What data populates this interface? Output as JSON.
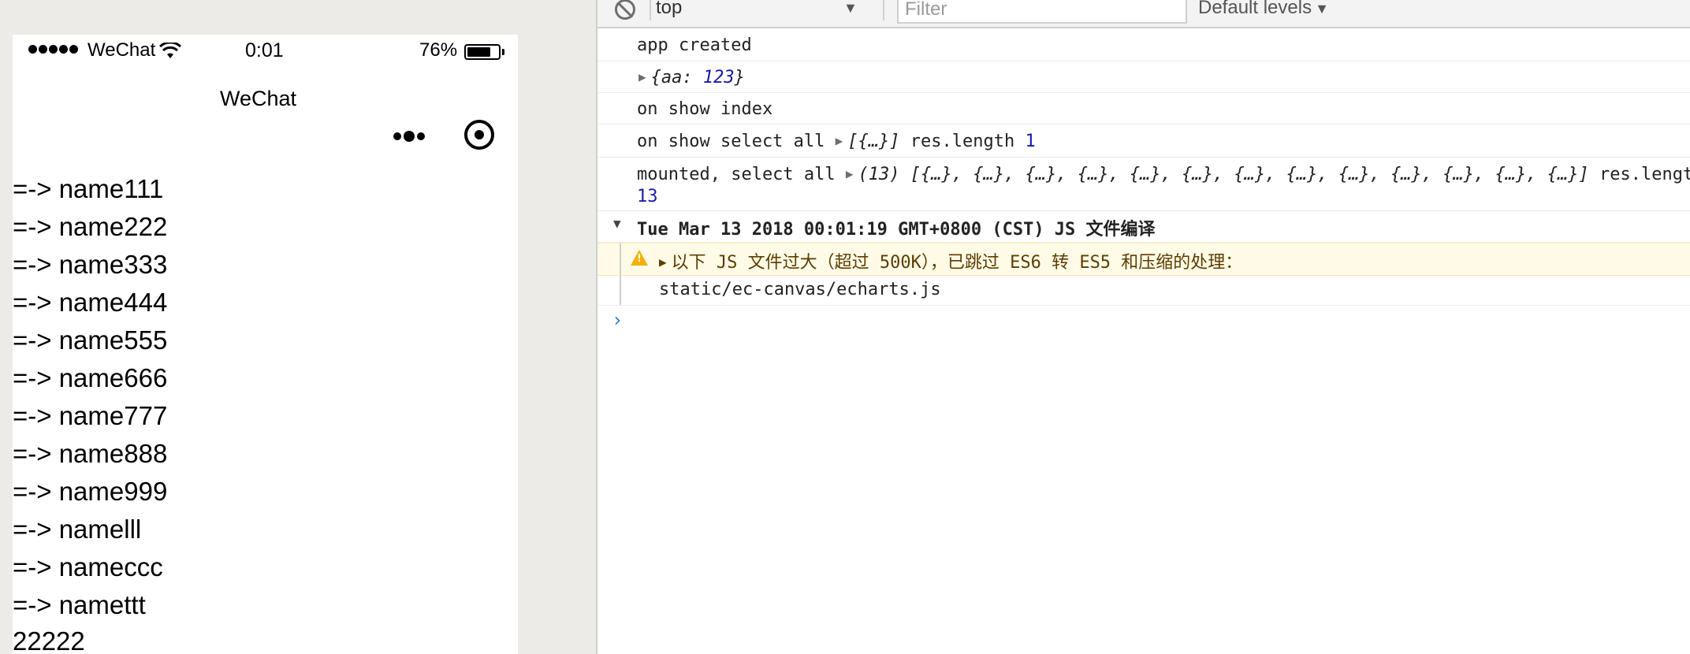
{
  "statusbar": {
    "carrier": "WeChat",
    "time": "0:01",
    "battery_percent": "76%",
    "battery_level": 0.76,
    "signal_bars": 5
  },
  "navbar": {
    "title": "WeChat",
    "more_icon": "more-dots-icon",
    "close_icon": "target-close-icon"
  },
  "page": {
    "items": [
      "=-> name111",
      "=-> name222",
      "=-> name333",
      "=-> name444",
      "=-> name555",
      "=-> name666",
      "=-> name777",
      "=-> name888",
      "=-> name999",
      "=-> namelll",
      "=-> nameccc",
      "=-> namettt"
    ],
    "footer": "22222"
  },
  "devtools": {
    "toolbar": {
      "context": "top",
      "filter_placeholder": "Filter",
      "levels": "Default levels"
    },
    "console": {
      "app_created": "app created",
      "obj_open": "{aa: ",
      "obj_val": "123",
      "obj_close": "}",
      "on_show_index": "on show index",
      "select_all_label": "on show select all",
      "select_all_preview": "[{…}]",
      "select_all_len_label": "res.length",
      "select_all_len": "1",
      "mounted_label": "mounted, select all",
      "mounted_preview": "(13) [{…}, {…}, {…}, {…}, {…}, {…}, {…}, {…}, {…}, {…}, {…}, {…}, {…}]",
      "mounted_len_label": "res.length",
      "mounted_len": "13",
      "group_title": "Tue Mar 13 2018 00:01:19 GMT+0800 (CST) JS 文件编译",
      "warning": "以下 JS 文件过大（超过 500K），已跳过 ES6 转 ES5 和压缩的处理：",
      "file_path": "static/ec-canvas/echarts.js"
    },
    "colors": {
      "number": "#1a1aa6",
      "warning_bg": "#fffbe6",
      "warning_icon": "#f2b000",
      "prompt": "#2a7ae2"
    }
  }
}
